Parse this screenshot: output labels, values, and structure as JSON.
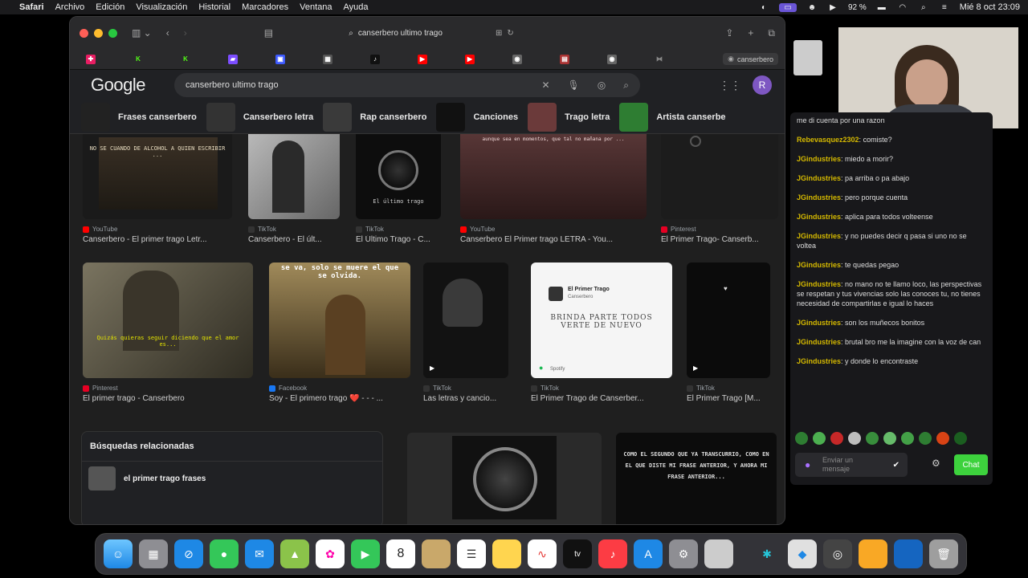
{
  "menubar": {
    "items": [
      "Safari",
      "Archivo",
      "Edición",
      "Visualización",
      "Historial",
      "Marcadores",
      "Ventana",
      "Ayuda"
    ],
    "battery": "92 %",
    "clock": "Mié 8 oct 23:09"
  },
  "browser": {
    "address": "canserbero ultimo trago",
    "active_tab": "canserbero"
  },
  "google": {
    "logo": "Google",
    "query": "canserbero ultimo trago",
    "avatar_letter": "R",
    "chips": [
      "Frases canserbero",
      "Canserbero letra",
      "Rap canserbero",
      "Canciones",
      "Trago letra",
      "Artista canserbe"
    ]
  },
  "results_row1": [
    {
      "source": "YouTube",
      "title": "Canserbero - El primer trago Letr...",
      "overlay": "NO SE CUANDO DE ALCOHOL A QUIEN ESCRIBIR ..."
    },
    {
      "source": "TikTok",
      "title": "Canserbero - El últ...",
      "overlay": ""
    },
    {
      "source": "TikTok",
      "title": "El Último Trago - C...",
      "overlay": "El último trago"
    },
    {
      "source": "YouTube",
      "title": "Canserbero El Primer trago LETRA - You...",
      "overlay": "aunque sea en momentos, que tal no mañana por ..."
    },
    {
      "source": "Pinterest",
      "title": "El Primer Trago- Canserb...",
      "overlay": ""
    }
  ],
  "results_row2": [
    {
      "source": "Pinterest",
      "title": "El primer trago - Canserbero",
      "overlay": "Quizás quieras seguir diciendo que el amor es..."
    },
    {
      "source": "Facebook",
      "title": "Soy - El primero trago ❤️ - - - ...",
      "overlay": "se va, solo se muere el que se olvida."
    },
    {
      "source": "TikTok",
      "title": "Las letras y cancio...",
      "overlay": ""
    },
    {
      "source": "TikTok",
      "title": "El Primer Trago de Canserber...",
      "overlay_title": "El Primer Trago",
      "overlay_artist": "Canserbero",
      "overlay_hand": "BRINDA PARTE TODOS VERTE DE NUEVO",
      "overlay_brand": "Spotify"
    },
    {
      "source": "TikTok",
      "title": "El Primer Trago [M...",
      "overlay": ""
    }
  ],
  "related": {
    "heading": "Búsquedas relacionadas",
    "items": [
      "el primer trago frases"
    ]
  },
  "bottom_text": {
    "card3": "COMO EL SEGUNDO QUE YA TRANSCURRIO, COMO EN EL QUE DISTE MI FRASE ANTERIOR, Y AHORA MI FRASE ANTERIOR..."
  },
  "chat": {
    "messages": [
      {
        "user": "",
        "text": "me di cuenta por una razon",
        "color": "#dddddd"
      },
      {
        "user": "Rebevasquez2302",
        "text": "comiste?",
        "color": "#d4b800"
      },
      {
        "user": "JGindustries",
        "text": "miedo a morir?",
        "color": "#d4b800"
      },
      {
        "user": "JGindustries",
        "text": "pa arriba o pa abajo",
        "color": "#d4b800"
      },
      {
        "user": "JGindustries",
        "text": "pero porque cuenta",
        "color": "#d4b800"
      },
      {
        "user": "JGindustries",
        "text": "aplica para todos volteense",
        "color": "#d4b800"
      },
      {
        "user": "JGindustries",
        "text": "y no puedes decir q pasa si uno no se voltea",
        "color": "#d4b800"
      },
      {
        "user": "JGindustries",
        "text": "te quedas pegao",
        "color": "#d4b800"
      },
      {
        "user": "JGindustries",
        "text": "no mano no te llamo loco, las perspectivas se respetan y tus vivencias solo las conoces tu, no tienes necesidad de compartirlas e igual lo haces",
        "color": "#d4b800"
      },
      {
        "user": "JGindustries",
        "text": "son los muñecos bonitos",
        "color": "#d4b800"
      },
      {
        "user": "JGindustries",
        "text": "brutal bro me la imagine con la voz de can",
        "color": "#d4b800"
      },
      {
        "user": "JGindustries",
        "text": "y donde lo encontraste",
        "color": "#d4b800"
      }
    ],
    "input_placeholder": "Enviar un mensaje",
    "send_label": "Chat"
  },
  "dock": {
    "calendar_day": "8",
    "apps": [
      "finder-icon",
      "launchpad-icon",
      "safari-icon",
      "messages-icon",
      "mail-icon",
      "maps-icon",
      "photos-icon",
      "facetime-icon",
      "calendar-icon",
      "notes-icon",
      "reminders-icon",
      "notes-yellow-icon",
      "freeform-icon",
      "appletv-icon",
      "music-icon",
      "appstore-icon",
      "settings-icon",
      "preview-icon",
      "obs-icon",
      "roblox-icon",
      "chrome-icon",
      "folder-icon",
      "files-icon",
      "trash-icon"
    ]
  }
}
